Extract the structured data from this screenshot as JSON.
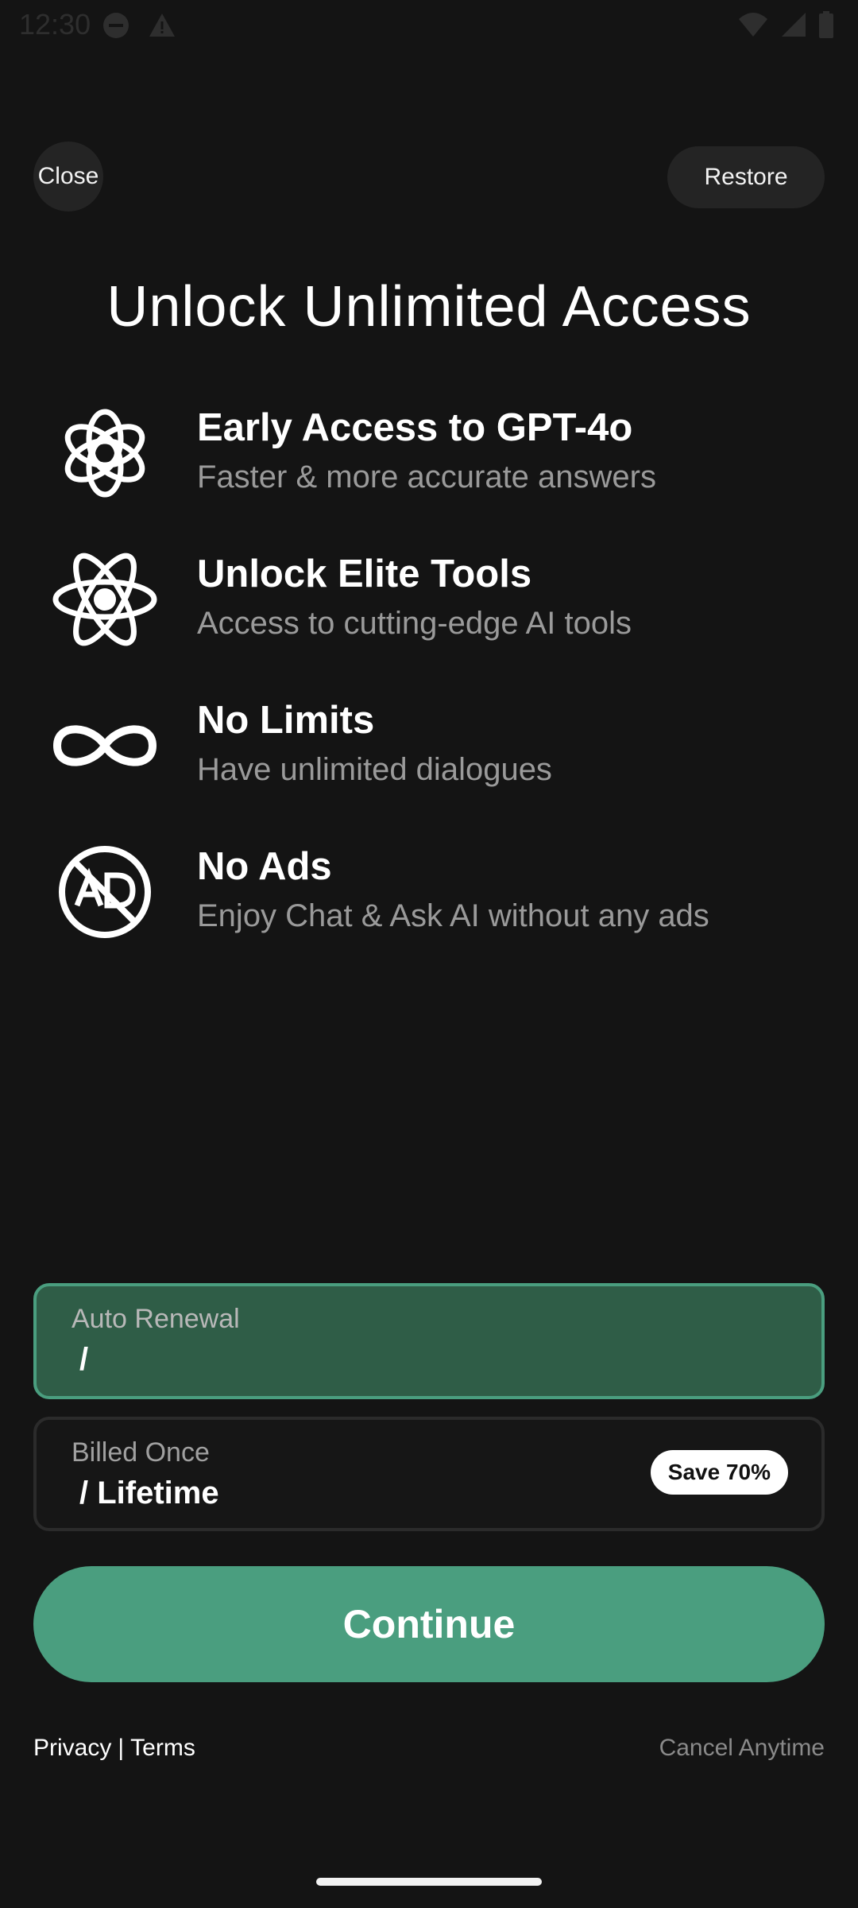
{
  "status_bar": {
    "time": "12:30",
    "left_icons": [
      "dnd-icon",
      "warning-icon"
    ],
    "right_icons": [
      "wifi-icon",
      "signal-icon",
      "battery-icon"
    ]
  },
  "header": {
    "close_label": "Close",
    "restore_label": "Restore"
  },
  "title": "Unlock Unlimited Access",
  "features": [
    {
      "icon": "openai-logo-icon",
      "title": "Early Access to GPT-4o",
      "subtitle": "Faster & more accurate answers"
    },
    {
      "icon": "atom-icon",
      "title": "Unlock Elite Tools",
      "subtitle": "Access to cutting-edge AI tools"
    },
    {
      "icon": "infinity-icon",
      "title": "No Limits",
      "subtitle": "Have unlimited dialogues"
    },
    {
      "icon": "no-ads-icon",
      "title": "No Ads",
      "subtitle": "Enjoy Chat & Ask AI without any ads"
    }
  ],
  "plans": [
    {
      "label": "Auto Renewal",
      "price": " /",
      "selected": true
    },
    {
      "label": "Billed Once",
      "price": " / Lifetime",
      "badge": "Save 70%",
      "selected": false
    }
  ],
  "continue_label": "Continue",
  "footer": {
    "privacy": "Privacy",
    "separator": "|",
    "terms": "Terms",
    "cancel": "Cancel Anytime"
  },
  "colors": {
    "background": "#141414",
    "accent": "#4a9e7f",
    "selected_plan_bg": "#2f5d47",
    "muted_text": "#9a9a9a"
  }
}
